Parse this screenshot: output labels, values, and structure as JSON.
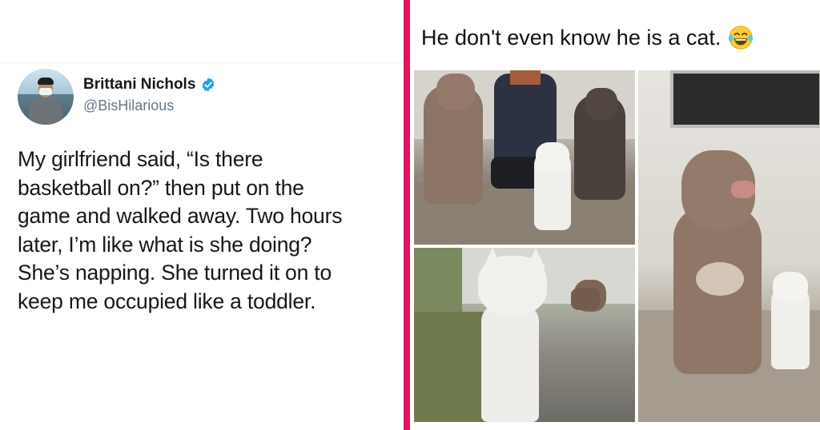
{
  "tweet": {
    "display_name": "Brittani Nichols",
    "handle": "@BisHilarious",
    "text": "My girlfriend said, “Is there\nbasketball on?” then put on the\ngame and walked away. Two hours\nlater, I’m like what is she doing?\nShe’s napping. She turned it on to\nkeep me occupied like a toddler.",
    "verified_icon": "verified-badge-icon",
    "accent_color": "#1da1f2"
  },
  "divider_color": "#e2135f",
  "meme": {
    "caption": "He don't even know he is a cat.",
    "emoji_icon": "laughing-crying-emoji-icon",
    "photos": [
      {
        "name": "dogs-and-cat-with-man-photo"
      },
      {
        "name": "white-cat-closeup-photo"
      },
      {
        "name": "pitbull-and-cat-standing-photo"
      }
    ]
  }
}
